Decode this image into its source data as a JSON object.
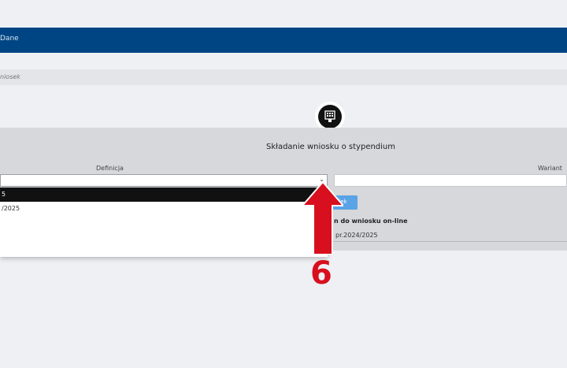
{
  "topbar": {
    "label": "Dane"
  },
  "breadcrumb": {
    "label": "niosek"
  },
  "panel": {
    "title": "Składanie wniosku o stypendium",
    "label_definicja": "Definicja",
    "label_wariant": "Wariant"
  },
  "select_definicja": {
    "value": "",
    "chevron": "⌄"
  },
  "dropdown": {
    "options": [
      "5",
      "/2025"
    ]
  },
  "button": {
    "label": "ojek"
  },
  "info": {
    "online": "n do wniosku on-line",
    "year": "pr.2024/2025"
  },
  "annotation": {
    "step": "6",
    "color": "#d80f1e"
  },
  "colors": {
    "topbar": "#004583",
    "panel": "#d6d8db",
    "button": "#5aa3e6"
  }
}
